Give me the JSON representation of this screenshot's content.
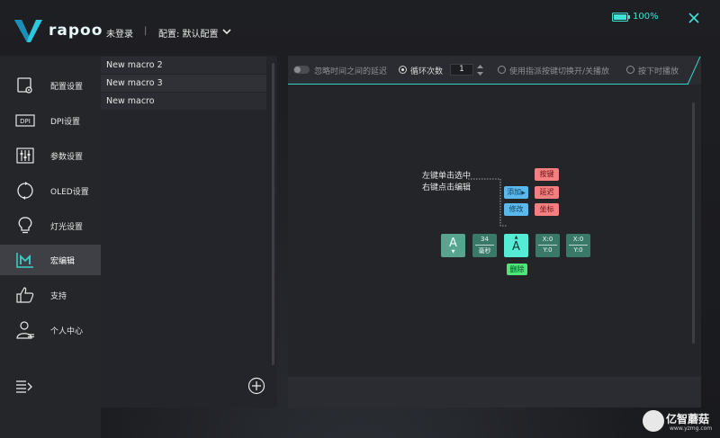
{
  "brand": {
    "logo_text": "rapoo"
  },
  "header": {
    "login_status": "未登录",
    "separator": "|",
    "profile_label": "配置: 默认配置",
    "battery_text": "100%",
    "battery_level": 1.0
  },
  "sidebar": {
    "items": [
      {
        "label": "配置设置",
        "icon": "settings-card-icon",
        "active": false
      },
      {
        "label": "DPI设置",
        "icon": "dpi-icon",
        "active": false
      },
      {
        "label": "参数设置",
        "icon": "sliders-icon",
        "active": false
      },
      {
        "label": "OLED设置",
        "icon": "oled-refresh-icon",
        "active": false
      },
      {
        "label": "灯光设置",
        "icon": "lightbulb-icon",
        "active": false
      },
      {
        "label": "宏编辑",
        "icon": "macro-icon",
        "active": true
      },
      {
        "label": "支持",
        "icon": "thumbs-up-icon",
        "active": false
      },
      {
        "label": "个人中心",
        "icon": "user-icon",
        "active": false
      }
    ]
  },
  "macro_list": {
    "items": [
      {
        "name": "New macro 2"
      },
      {
        "name": "New macro 3"
      },
      {
        "name": "New macro"
      }
    ]
  },
  "toolbar": {
    "ignore_delay_label": "忽略时间之间的延迟",
    "loop_label": "循环次数",
    "loop_count": "1",
    "toggle_on_press_label": "使用指派按键切换开/关播放",
    "play_on_hold_label": "按下时播放"
  },
  "demo": {
    "hint_line1": "左键单击选中",
    "hint_line2": "右键点击编辑",
    "add_label": "添加",
    "edit_label": "修改",
    "key_label": "按键",
    "delay_label": "延迟",
    "coord_label": "坐标",
    "delete_label": "删除",
    "chips": {
      "key_letter": "A",
      "delay_value": "34",
      "delay_unit": "毫秒",
      "selected_letter": "A",
      "coord1_x": "X:0",
      "coord1_y": "Y:0",
      "coord2_x": "X:0",
      "coord2_y": "Y:0"
    }
  },
  "watermark": {
    "text": "亿智蘑菇",
    "url": "www.yzmg.com"
  },
  "colors": {
    "accent": "#3fe3d6",
    "active_nav": "#3e4046",
    "chip_key": "#59a48e",
    "chip_selected": "#55ecd6",
    "btn_blue": "#5ab8ec",
    "btn_red": "#f37f80",
    "btn_green": "#4fe57a"
  }
}
